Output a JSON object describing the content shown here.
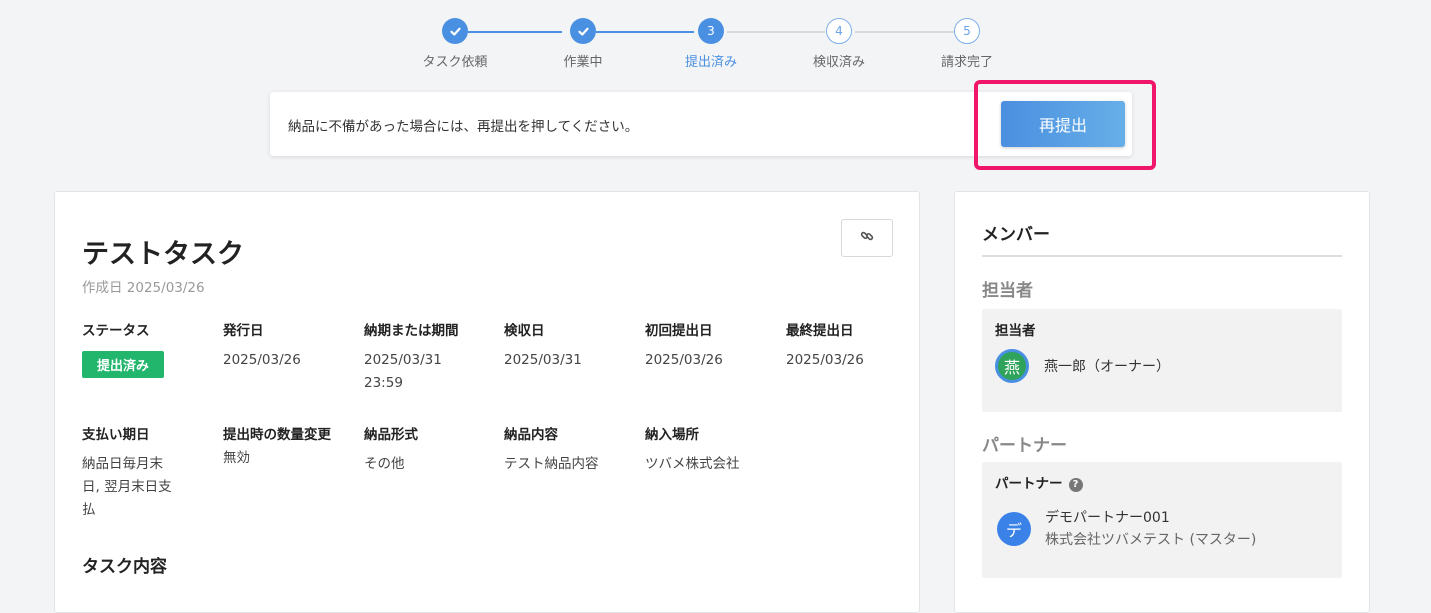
{
  "stepper": {
    "steps": [
      {
        "label": "タスク依頼",
        "state": "done",
        "number": "1"
      },
      {
        "label": "作業中",
        "state": "done",
        "number": "2"
      },
      {
        "label": "提出済み",
        "state": "current",
        "number": "3"
      },
      {
        "label": "検収済み",
        "state": "todo",
        "number": "4"
      },
      {
        "label": "請求完了",
        "state": "todo",
        "number": "5"
      }
    ]
  },
  "notice": {
    "text": "納品に不備があった場合には、再提出を押してください。",
    "resubmit_label": "再提出",
    "highlight_color": "#f0166a"
  },
  "task": {
    "title": "テストタスク",
    "created": "作成日 2025/03/26",
    "link_icon": "link-icon",
    "fields": {
      "status": {
        "label": "ステータス",
        "value": "提出済み"
      },
      "issue_date": {
        "label": "発行日",
        "value": "2025/03/26"
      },
      "deadline": {
        "label": "納期または期間",
        "value": "2025/03/31 23:59"
      },
      "inspection_date": {
        "label": "検収日",
        "value": "2025/03/31"
      },
      "first_submit": {
        "label": "初回提出日",
        "value": "2025/03/26"
      },
      "last_submit": {
        "label": "最終提出日",
        "value": "2025/03/26"
      },
      "payment_due": {
        "label": "支払い期日",
        "value": "納品日毎月末日, 翌月末日支払"
      },
      "qty_change": {
        "label": "提出時の数量変更",
        "value": "無効"
      },
      "delivery_format": {
        "label": "納品形式",
        "value": "その他"
      },
      "delivery_content": {
        "label": "納品内容",
        "value": "テスト納品内容"
      },
      "delivery_place": {
        "label": "納入場所",
        "value": "ツバメ株式会社"
      }
    },
    "section_title": "タスク内容"
  },
  "members": {
    "title": "メンバー",
    "assignee_group": "担当者",
    "assignee_label": "担当者",
    "assignee": {
      "avatar": "燕",
      "name": "燕一郎（オーナー）"
    },
    "partner_group": "パートナー",
    "partner_label": "パートナー",
    "partner": {
      "avatar": "デ",
      "name": "デモパートナー001",
      "company": "株式会社ツバメテスト (マスター)"
    }
  },
  "colors": {
    "accent": "#4a90e2",
    "status_badge": "#21b66c"
  }
}
